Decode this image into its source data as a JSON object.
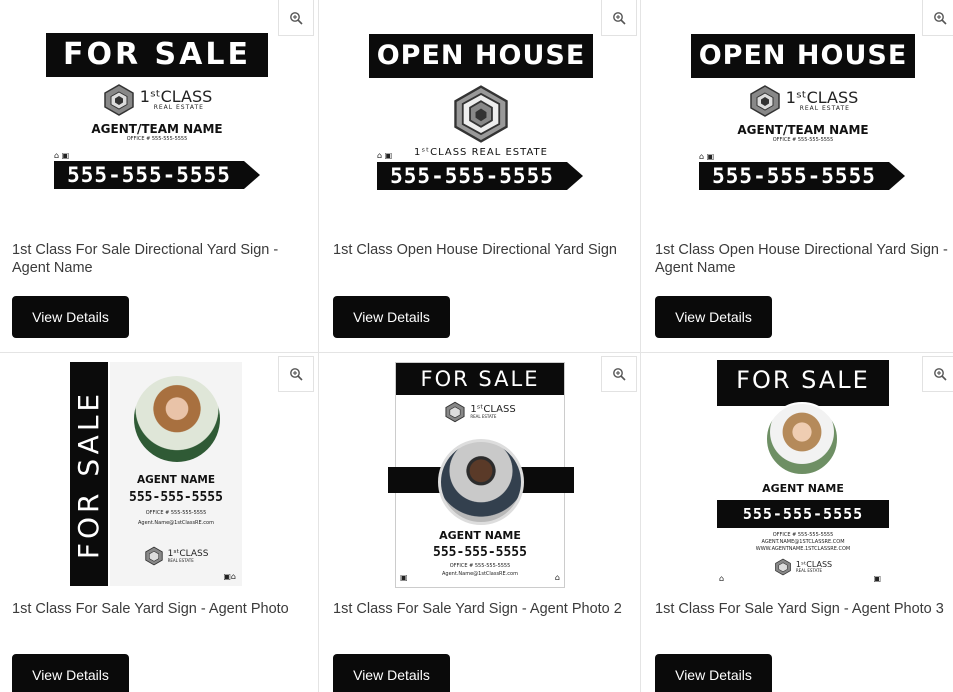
{
  "products": [
    {
      "title": "1st Class For Sale Directional Yard Sign - Agent Name",
      "button": "View Details",
      "sign": {
        "header": "FOR SALE",
        "brand": "1ˢᵗCLASS",
        "brand_sub": "REAL ESTATE",
        "agent": "AGENT/TEAM NAME",
        "office": "OFFICE # 555-555-5555",
        "phone": "555-555-5555"
      }
    },
    {
      "title": "1st Class Open House Directional Yard Sign",
      "button": "View Details",
      "sign": {
        "header": "OPEN HOUSE",
        "brand_line": "1ˢᵗCLASS REAL ESTATE",
        "phone": "555-555-5555"
      }
    },
    {
      "title": "1st Class Open House Directional Yard Sign - Agent Name",
      "button": "View Details",
      "sign": {
        "header": "OPEN HOUSE",
        "brand": "1ˢᵗCLASS",
        "brand_sub": "REAL ESTATE",
        "agent": "AGENT/TEAM NAME",
        "office": "OFFICE # 555-555-5555",
        "phone": "555-555-5555"
      }
    },
    {
      "title": "1st Class For Sale Yard Sign - Agent Photo",
      "button": "View Details",
      "sign": {
        "header": "FOR SALE",
        "agent": "AGENT NAME",
        "phone": "555-555-5555",
        "office": "OFFICE # 555-555-5555",
        "email": "Agent.Name@1stClassRE.com",
        "brand": "1ˢᵗCLASS",
        "brand_sub": "REAL ESTATE"
      }
    },
    {
      "title": "1st Class For Sale Yard Sign - Agent Photo 2",
      "button": "View Details",
      "sign": {
        "header": "FOR SALE",
        "brand": "1ˢᵗCLASS",
        "brand_sub": "REAL ESTATE",
        "agent": "AGENT NAME",
        "phone": "555-555-5555",
        "office": "OFFICE # 555-555-5555",
        "email": "Agent.Name@1stClassRE.com"
      }
    },
    {
      "title": "1st Class For Sale Yard Sign - Agent Photo 3",
      "button": "View Details",
      "sign": {
        "header": "FOR SALE",
        "agent": "AGENT NAME",
        "phone": "555-555-5555",
        "office": "OFFICE # 555-555-5555",
        "email": "AGENT.NAME@1STCLASSRE.COM",
        "web": "WWW.AGENTNAME.1STCLASSRE.COM",
        "brand": "1ˢᵗCLASS",
        "brand_sub": "REAL ESTATE"
      }
    }
  ],
  "zoom_icon": "magnifier-plus-icon",
  "colors": {
    "sign_black": "#0b0b0b",
    "button_bg": "#0a0a0a",
    "divider": "#e4e4e4"
  }
}
